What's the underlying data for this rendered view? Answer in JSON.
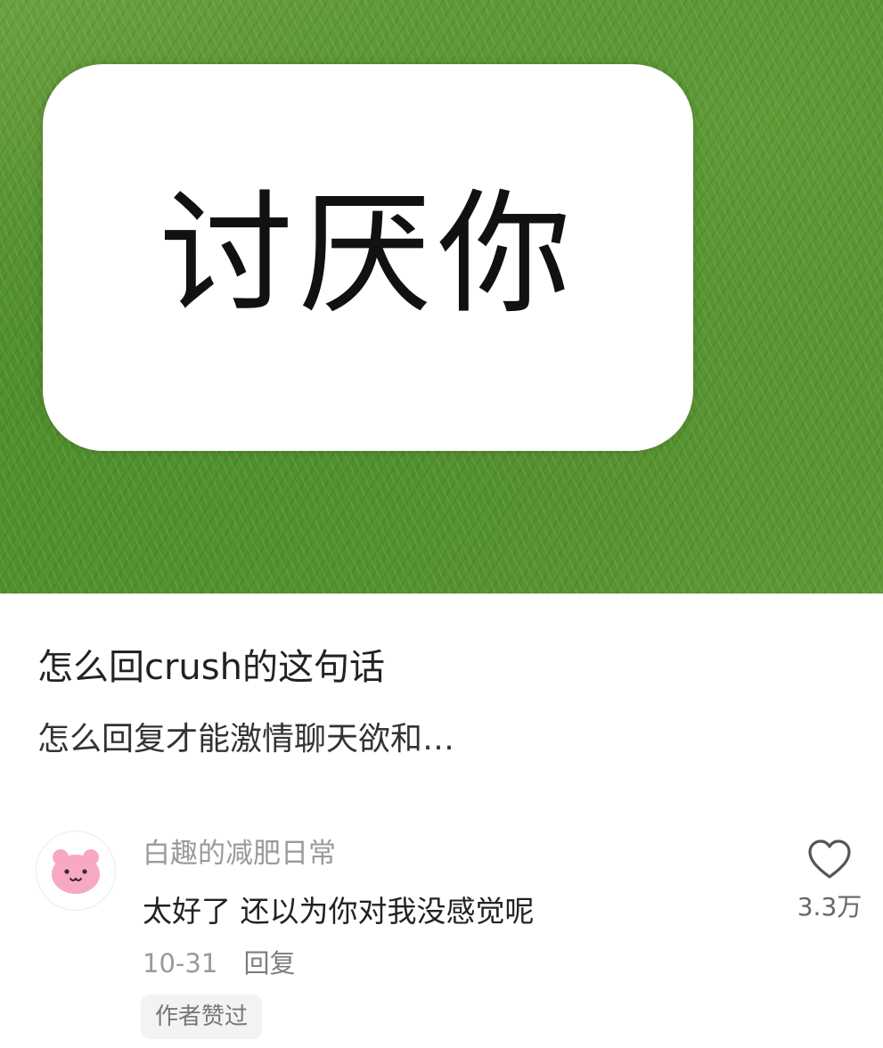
{
  "hero": {
    "sign_text": "讨厌你"
  },
  "post": {
    "title": "怎么回crush的这句话",
    "subtitle": "怎么回复才能激情聊天欲和…"
  },
  "comment": {
    "username": "白趣的减肥日常",
    "text": "太好了 还以为你对我没感觉呢",
    "date": "10-31",
    "reply_label": "回复",
    "author_liked_label": "作者赞过",
    "like_count": "3.3万",
    "avatar_icon": "pink-bear-icon",
    "like_icon": "heart-outline-icon"
  },
  "colors": {
    "grass": "#5a9632",
    "avatar_pink": "#f7a8c4",
    "muted_text": "#9a9a9a"
  }
}
